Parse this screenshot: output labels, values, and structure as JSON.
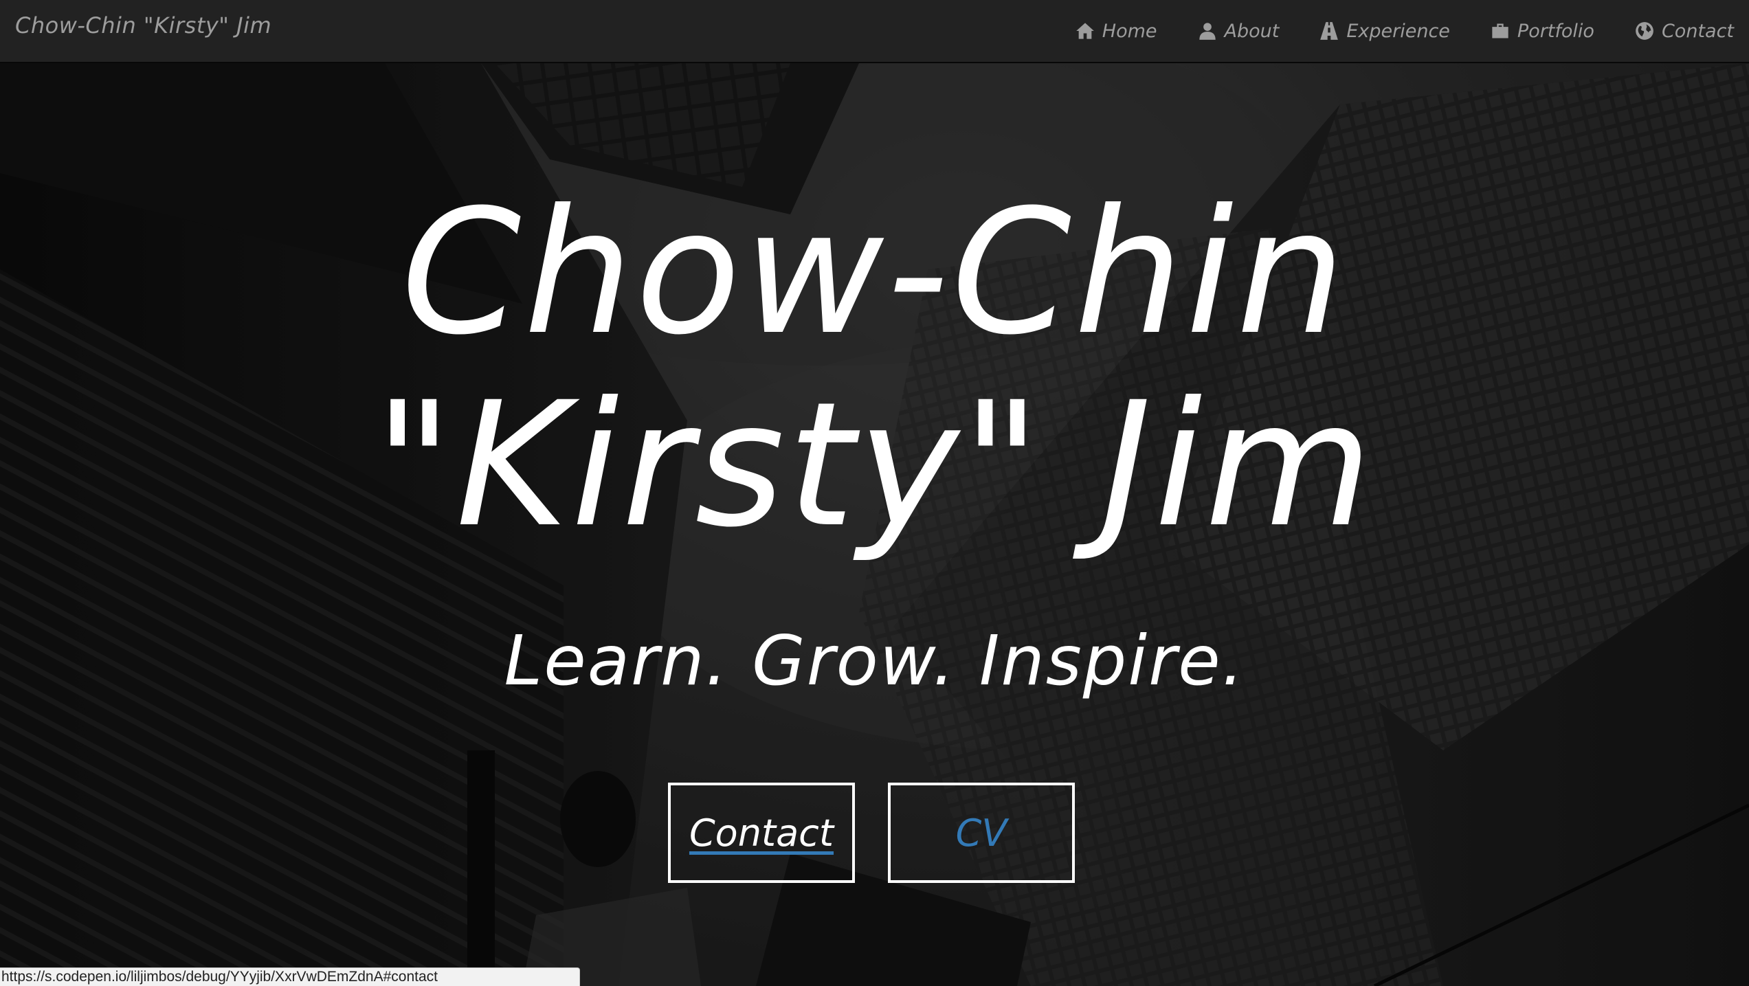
{
  "navbar": {
    "brand": "Chow-Chin \"Kirsty\" Jim",
    "items": [
      {
        "label": "Home",
        "icon": "home-icon"
      },
      {
        "label": "About",
        "icon": "user-icon"
      },
      {
        "label": "Experience",
        "icon": "road-icon"
      },
      {
        "label": "Portfolio",
        "icon": "briefcase-icon"
      },
      {
        "label": "Contact",
        "icon": "globe-icon"
      }
    ]
  },
  "hero": {
    "title_line1": "Chow-Chin",
    "title_line2": "\"Kirsty\" Jim",
    "tagline": "Learn. Grow. Inspire.",
    "buttons": {
      "contact_label": "Contact",
      "cv_label": "CV"
    }
  },
  "status_bar": {
    "url": "https://s.codepen.io/liljimbos/debug/YYyjib/XxrVwDEmZdnA#contact"
  },
  "colors": {
    "navbar_bg": "#222222",
    "nav_text": "#9d9d9d",
    "link_blue": "#337ab7",
    "hero_text": "#ffffff"
  }
}
